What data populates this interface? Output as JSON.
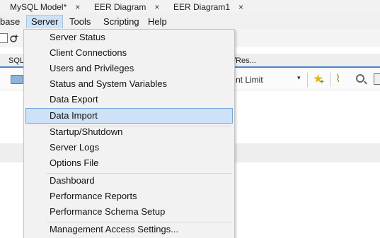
{
  "doc_tabs": [
    {
      "label": "MySQL Model*",
      "close": "×"
    },
    {
      "label": "EER Diagram",
      "close": "×"
    },
    {
      "label": "EER Diagram1",
      "close": "×"
    }
  ],
  "menubar": {
    "base": "base",
    "server": "Server",
    "tools": "Tools",
    "scripting": "Scripting",
    "help": "Help"
  },
  "editor_tabs": {
    "sql": "SQL",
    "res": "/Res..."
  },
  "editor_toolbar": {
    "limit": "nt Limit",
    "limit_arrow": "▾"
  },
  "server_menu": {
    "items": [
      "Server Status",
      "Client Connections",
      "Users and Privileges",
      "Status and System Variables",
      "Data Export",
      "Data Import",
      "Startup/Shutdown",
      "Server Logs",
      "Options File",
      "Dashboard",
      "Performance Reports",
      "Performance Schema Setup",
      "Management Access Settings..."
    ],
    "highlighted_index": 5
  },
  "colors": {
    "menu_highlight": "#cde2f7",
    "menu_highlight_border": "#7aa7d6",
    "editor_tab_underline": "#4a86c8"
  },
  "icons": [
    "close-icon",
    "folder-icon",
    "star-add-icon",
    "broom-icon",
    "magnifier-icon"
  ]
}
